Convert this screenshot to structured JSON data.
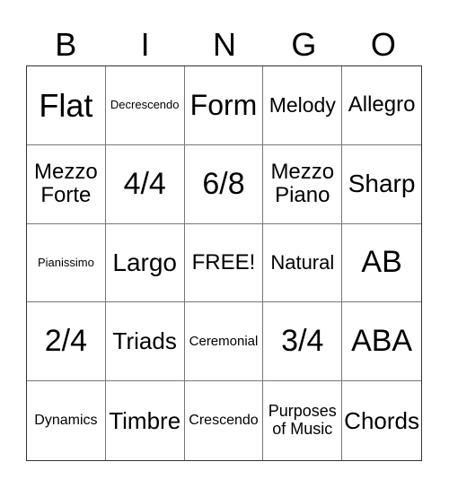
{
  "header": [
    "B",
    "I",
    "N",
    "G",
    "O"
  ],
  "rows": [
    [
      "Flat",
      "Decrescendo",
      "Form",
      "Melody",
      "Allegro"
    ],
    [
      "Mezzo Forte",
      "4/4",
      "6/8",
      "Mezzo Piano",
      "Sharp"
    ],
    [
      "Pianissimo",
      "Largo",
      "FREE!",
      "Natural",
      "AB"
    ],
    [
      "2/4",
      "Triads",
      "Ceremonial",
      "3/4",
      "ABA"
    ],
    [
      "Dynamics",
      "Timbre",
      "Crescendo",
      "Purposes of Music",
      "Chords"
    ]
  ]
}
